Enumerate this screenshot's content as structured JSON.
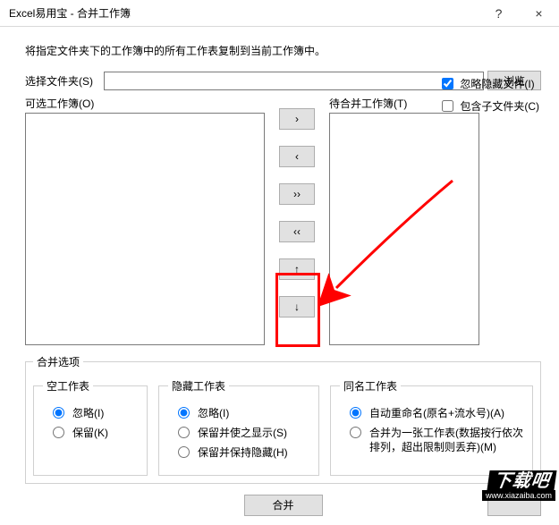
{
  "window": {
    "title": "Excel易用宝 - 合并工作簿",
    "help": "?",
    "close": "×"
  },
  "description": "将指定文件夹下的工作簿中的所有工作表复制到当前工作簿中。",
  "folder": {
    "label": "选择文件夹(S)",
    "value": "",
    "browse": "浏览"
  },
  "checkboxes": {
    "ignore_hidden": "忽略隐藏文件(I)",
    "ignore_hidden_checked": true,
    "include_sub": "包含子文件夹(C)",
    "include_sub_checked": false
  },
  "lists": {
    "left_label": "可选工作簿(O)",
    "right_label": "待合并工作簿(T)"
  },
  "mid_buttons": {
    "add": "›",
    "remove": "‹",
    "add_all": "››",
    "remove_all": "‹‹",
    "up": "↑",
    "down": "↓"
  },
  "merge_options": {
    "legend": "合并选项",
    "empty": {
      "legend": "空工作表",
      "ignore": "忽略(I)",
      "keep": "保留(K)"
    },
    "hidden": {
      "legend": "隐藏工作表",
      "ignore": "忽略(I)",
      "keep_show": "保留并使之显示(S)",
      "keep_hidden": "保留并保持隐藏(H)"
    },
    "samename": {
      "legend": "同名工作表",
      "auto_rename": "自动重命名(原名+流水号)(A)",
      "merge_one": "合并为一张工作表(数据按行依次排列，超出限制则丢弃)(M)"
    }
  },
  "actions": {
    "merge": "合并",
    "cancel": ""
  },
  "watermark": {
    "big": "下载吧",
    "url": "www.xiazaiba.com"
  }
}
